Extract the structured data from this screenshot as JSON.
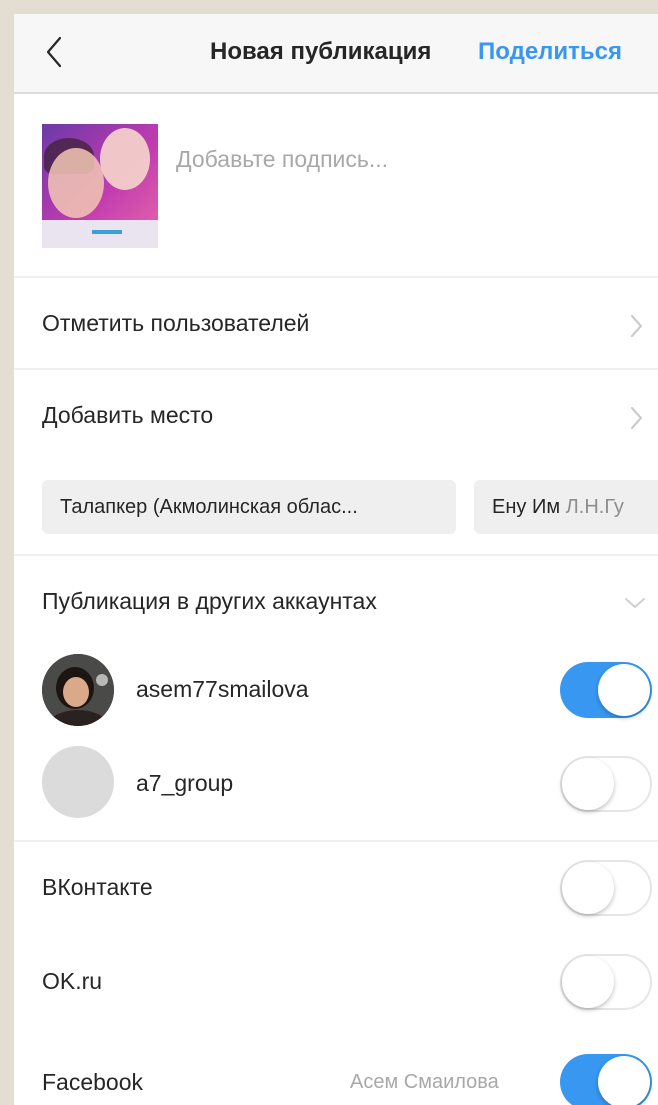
{
  "header": {
    "back_icon": "chevron-left-icon",
    "title": "Новая публикация",
    "share_label": "Поделиться"
  },
  "caption": {
    "placeholder": "Добавьте подпись..."
  },
  "options": {
    "tag_people_label": "Отметить пользователей",
    "add_location_label": "Добавить место"
  },
  "location_suggestions": [
    {
      "text": "Талапкер (Акмолинская облас..."
    },
    {
      "text": "Ену Им",
      "muted": "Л.Н.Гу"
    }
  ],
  "other_accounts": {
    "section_label": "Публикация в других аккаунтах",
    "accounts": [
      {
        "username": "asem77smailova",
        "enabled": true
      },
      {
        "username": "a7_group",
        "enabled": false
      }
    ]
  },
  "social": [
    {
      "label": "ВКонтакте",
      "enabled": false
    },
    {
      "label": "OK.ru",
      "enabled": false
    },
    {
      "label": "Facebook",
      "account": "Асем Смаилова",
      "enabled": true
    }
  ],
  "colors": {
    "accent": "#3897f0",
    "text": "#262626",
    "muted": "#a8a8a8",
    "chip_bg": "#efefef",
    "outer_bg": "#e4ddd2"
  }
}
